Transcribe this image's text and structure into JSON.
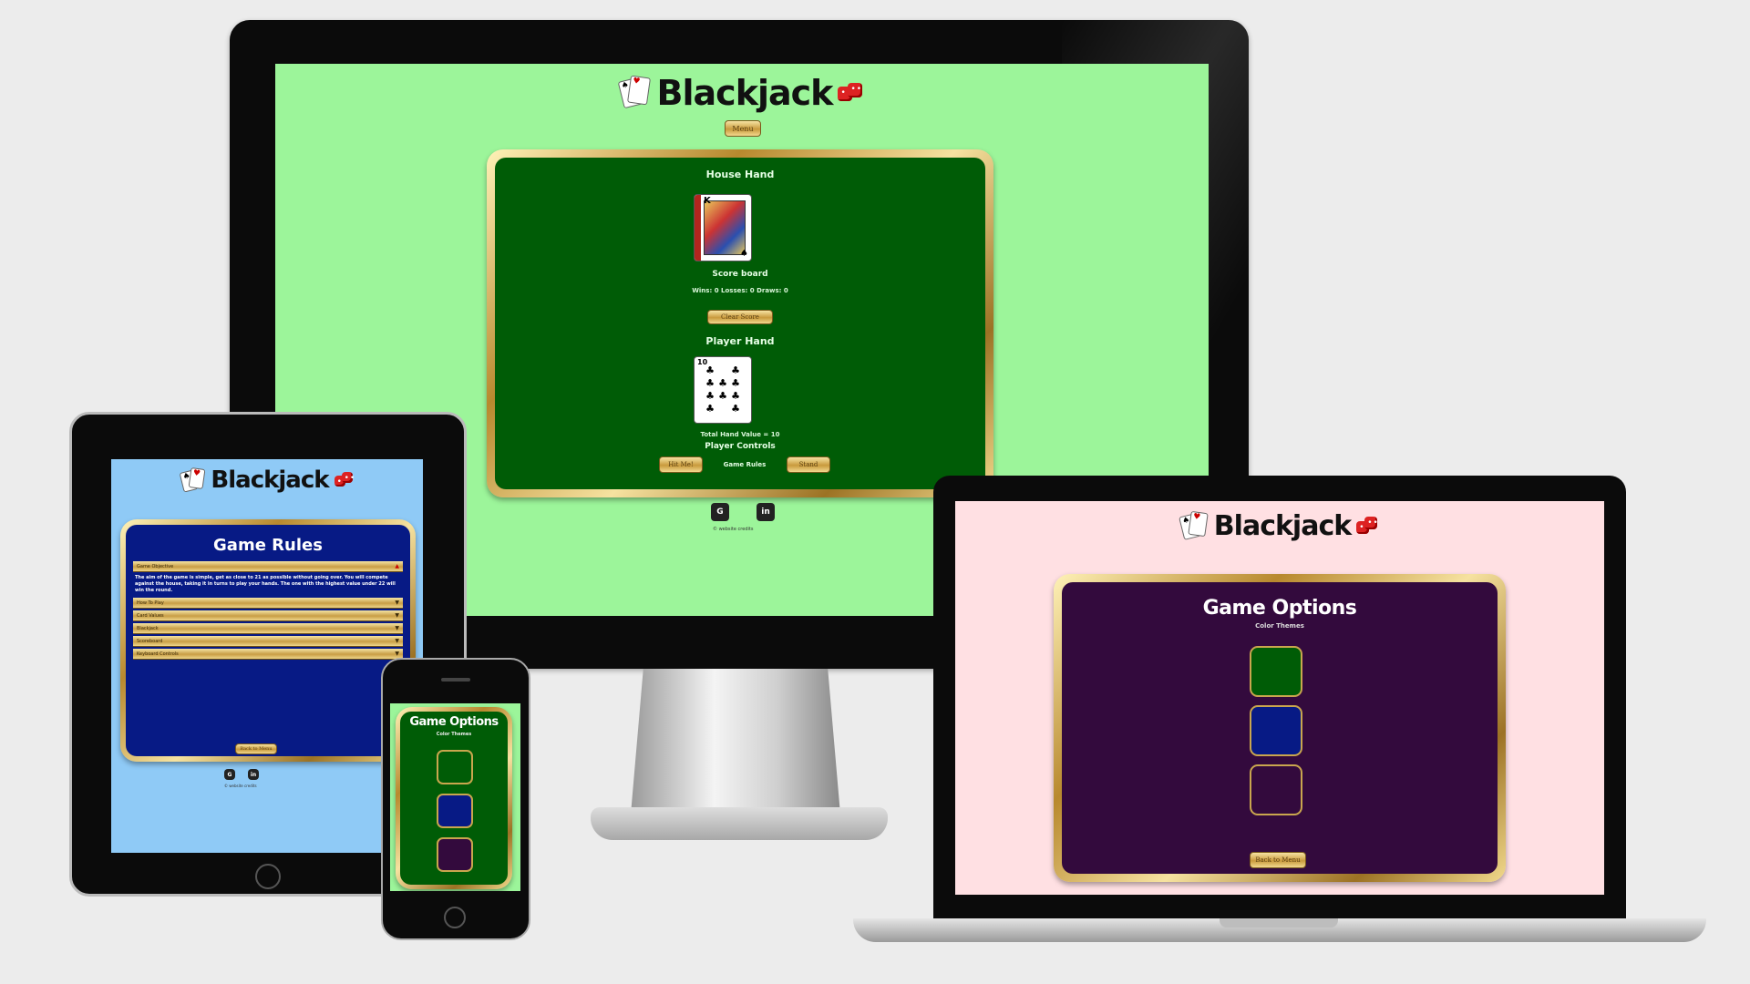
{
  "app": {
    "title": "Blackjack",
    "cards_icon": "playing-cards-icon",
    "dice_icon": "dice-icon"
  },
  "colors": {
    "monitor_bg": "#9cf59a",
    "tablet_bg": "#8fcaf6",
    "laptop_bg": "#ffe0e3",
    "felt_green": "#005c06",
    "felt_blue": "#071a85",
    "felt_purple": "#330a3d",
    "gold": "#c99a3c"
  },
  "monitor": {
    "menu_button": "Menu",
    "house_hand_label": "House Hand",
    "house_card": {
      "rank": "K",
      "suit": "♠"
    },
    "score_board_label": "Score board",
    "score_line": "Wins: 0 Losses: 0 Draws: 0",
    "clear_score_button": "Clear Score",
    "player_hand_label": "Player Hand",
    "player_card": {
      "rank": "10",
      "suit": "♣"
    },
    "total_value": "Total Hand Value = 10",
    "player_controls_label": "Player Controls",
    "hit_button": "Hit Me!",
    "game_rules_link": "Game Rules",
    "stand_button": "Stand",
    "social": [
      "github-icon",
      "linkedin-icon"
    ],
    "social_glyphs": [
      "G",
      "in"
    ],
    "credit": "© website credits"
  },
  "tablet": {
    "heading": "Game Rules",
    "rules": [
      {
        "title": "Game Objective",
        "open": true,
        "body": "The aim of the game is simple, get as close to 21 as possible without going over. You will compete against the house, taking it in turns to play your hands. The one with the highest value under 22 will win the round."
      },
      {
        "title": "How To Play",
        "open": false
      },
      {
        "title": "Card Values",
        "open": false
      },
      {
        "title": "Blackjack",
        "open": false
      },
      {
        "title": "Scoreboard",
        "open": false
      },
      {
        "title": "Keyboard Controls",
        "open": false
      }
    ],
    "back_button": "Back to Menu",
    "social_glyphs": [
      "G",
      "in"
    ],
    "credit": "© website credits"
  },
  "phone": {
    "heading": "Game Options",
    "subheading": "Color Themes",
    "themes": [
      {
        "name": "green-theme",
        "color": "#005c06"
      },
      {
        "name": "blue-theme",
        "color": "#071a85"
      },
      {
        "name": "purple-theme",
        "color": "#330a3d"
      }
    ]
  },
  "laptop": {
    "heading": "Game Options",
    "subheading": "Color Themes",
    "themes": [
      {
        "name": "green-theme",
        "color": "#005c06"
      },
      {
        "name": "blue-theme",
        "color": "#071a85"
      },
      {
        "name": "purple-theme",
        "color": "#330a3d"
      }
    ],
    "back_button": "Back to Menu"
  }
}
